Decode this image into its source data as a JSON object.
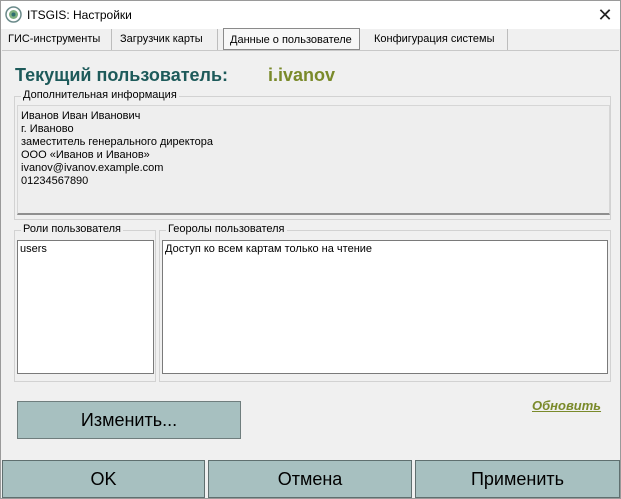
{
  "window": {
    "title": "ITSGIS: Настройки",
    "close_glyph": "✕"
  },
  "tabs": [
    {
      "label": "ГИС-инструменты",
      "active": false
    },
    {
      "label": "Загрузчик карты",
      "active": false
    },
    {
      "label": "Данные о пользователе",
      "active": true
    },
    {
      "label": "Конфигурация системы",
      "active": false
    }
  ],
  "user": {
    "heading": "Текущий пользователь:",
    "login": "i.ivanov"
  },
  "additional_info": {
    "legend": "Дополнительная информация",
    "lines": [
      "Иванов Иван Иванович",
      "г. Иваново",
      "заместитель генерального директора",
      "ООО «Иванов и Иванов»",
      "ivanov@ivanov.example.com",
      "01234567890"
    ]
  },
  "roles": {
    "legend": "Роли пользователя",
    "items": [
      "users"
    ]
  },
  "georoles": {
    "legend": "Георолы пользователя",
    "items": [
      "Доступ ко всем картам только на чтение"
    ]
  },
  "actions": {
    "edit_label": "Изменить...",
    "refresh_label": "Обновить"
  },
  "footer": {
    "ok_label": "OK",
    "cancel_label": "Отмена",
    "apply_label": "Применить"
  },
  "colors": {
    "accent_dark_teal": "#1d5a5a",
    "accent_olive": "#7a8a2a",
    "button_bg": "#a7c0c0"
  },
  "icons": {
    "app": "itsgis-logo-icon",
    "close": "close-icon"
  }
}
